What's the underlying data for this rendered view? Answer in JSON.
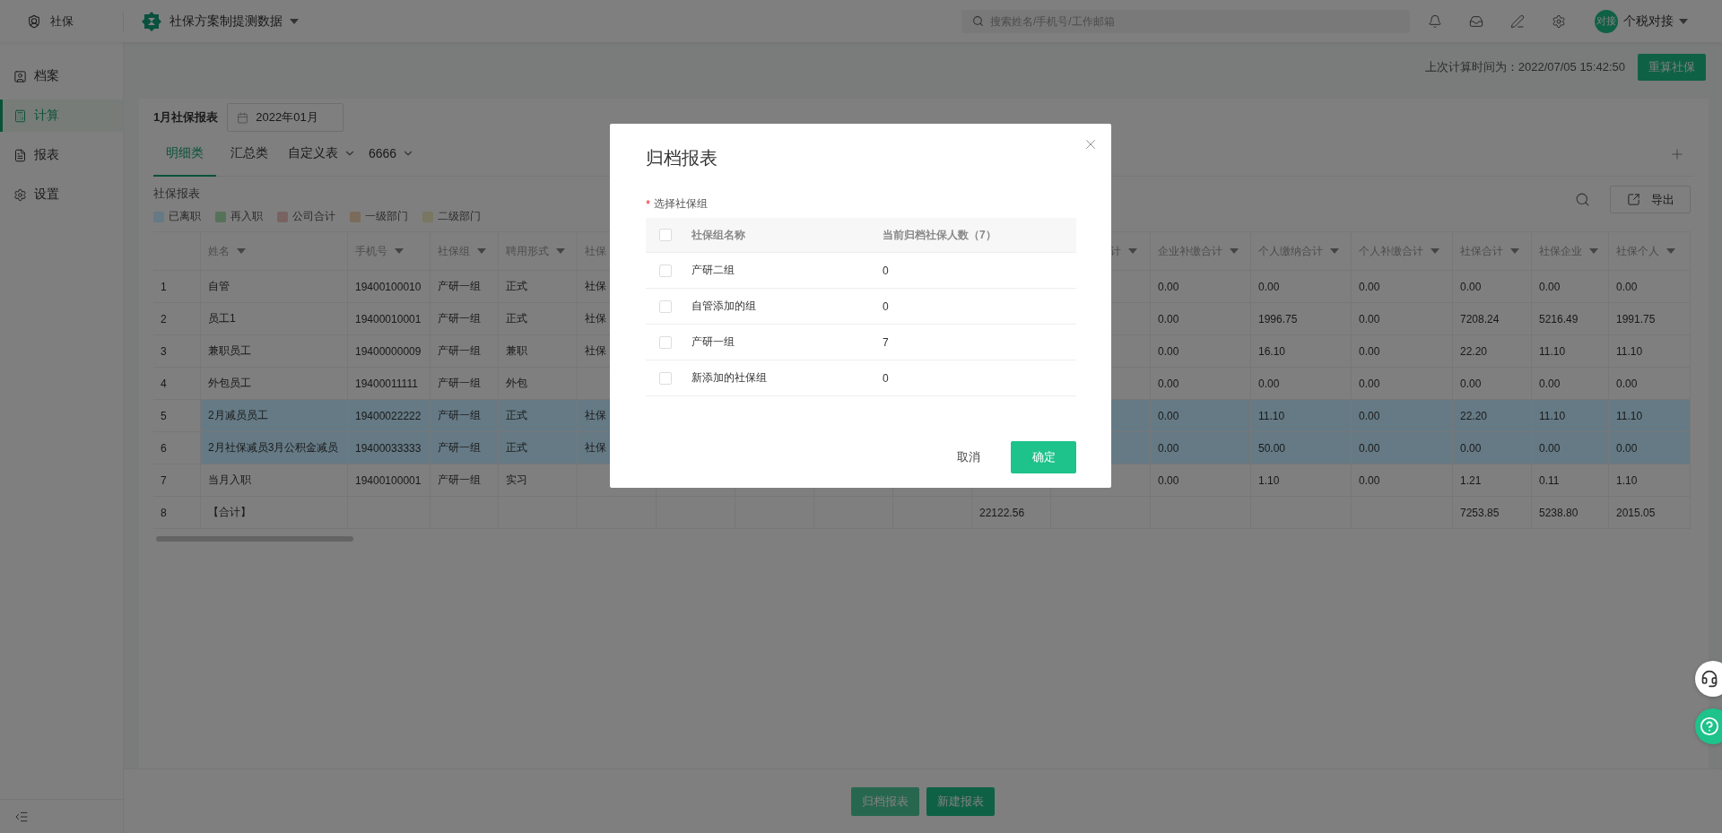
{
  "topbar": {
    "module": "社保",
    "scheme": "社保方案制提测数据",
    "search": {
      "placeholder": "搜索姓名/手机号/工作邮箱"
    },
    "user": {
      "avatar": "对接",
      "name": "个税对接"
    }
  },
  "sidebar": {
    "items": [
      {
        "label": "档案",
        "selected": false
      },
      {
        "label": "计算",
        "selected": true
      },
      {
        "label": "报表",
        "selected": false
      },
      {
        "label": "设置",
        "selected": false
      }
    ]
  },
  "info": {
    "last_calc": "上次计算时间为：2022/07/05 15:42:50",
    "recalc_button": "重算社保"
  },
  "report": {
    "title": "1月社保报表",
    "month": "2022年01月",
    "tabs": [
      {
        "label": "明细类",
        "selected": true,
        "dropdown": false
      },
      {
        "label": "汇总类",
        "selected": false,
        "dropdown": false
      },
      {
        "label": "自定义表",
        "selected": false,
        "dropdown": true
      },
      {
        "label": "6666",
        "selected": false,
        "dropdown": true
      }
    ],
    "table_title": "社保报表",
    "export_button": "导出",
    "legend": [
      {
        "label": "已离职",
        "color": "#657a85"
      },
      {
        "label": "再入职",
        "color": "#557259"
      },
      {
        "label": "公司合计",
        "color": "#796262"
      },
      {
        "label": "一级部门",
        "color": "#7a6b5a"
      },
      {
        "label": "二级部门",
        "color": "#797662"
      }
    ]
  },
  "table": {
    "columns": [
      {},
      {
        "header": "姓名",
        "sort": true
      },
      {
        "header": "手机号",
        "sort": true
      },
      {
        "header": "社保组",
        "sort": true
      },
      {
        "header": "聘用形式",
        "sort": true
      },
      {
        "header": "社保"
      },
      {},
      {},
      {},
      {},
      {},
      {
        "header": "计",
        "sort": true,
        "clipped": true
      },
      {
        "header": "企业补缴合计",
        "sort": true
      },
      {
        "header": "个人缴纳合计",
        "sort": true
      },
      {
        "header": "个人补缴合计",
        "sort": true
      },
      {
        "header": "社保合计",
        "sort": true
      },
      {
        "header": "社保企业",
        "sort": true
      },
      {
        "header": "社保个人",
        "sort": true
      }
    ],
    "rows": [
      {
        "cells": [
          "1",
          "自管",
          "19400100010",
          "产研一组",
          "正式",
          "社保",
          null,
          null,
          null,
          null,
          null,
          null,
          "0.00",
          "0.00",
          "0.00",
          "0.00",
          "0.00",
          "0.00"
        ]
      },
      {
        "cells": [
          "2",
          "员工1",
          "19400010001",
          "产研一组",
          "正式",
          "社保",
          null,
          null,
          null,
          null,
          null,
          null,
          "0.00",
          "1996.75",
          "0.00",
          "7208.24",
          "5216.49",
          "1991.75"
        ]
      },
      {
        "cells": [
          "3",
          "兼职员工",
          "19400000009",
          "产研一组",
          "兼职",
          "社保",
          null,
          null,
          null,
          null,
          null,
          null,
          "0.00",
          "16.10",
          "0.00",
          "22.20",
          "11.10",
          "11.10"
        ]
      },
      {
        "cells": [
          "4",
          "外包员工",
          "19400011111",
          "产研一组",
          "外包",
          null,
          null,
          null,
          null,
          null,
          null,
          null,
          "0.00",
          "0.00",
          "0.00",
          "0.00",
          "0.00",
          "0.00"
        ]
      },
      {
        "color": "#657a85",
        "cells": [
          "5",
          "2月减员员工",
          "19400022222",
          "产研一组",
          "正式",
          "社保",
          null,
          null,
          null,
          null,
          null,
          null,
          "0.00",
          "11.10",
          "0.00",
          "22.20",
          "11.10",
          "11.10"
        ]
      },
      {
        "color": "#657a85",
        "cells": [
          "6",
          "2月社保减员3月公积金减员",
          "19400033333",
          "产研一组",
          "正式",
          "社保",
          null,
          null,
          null,
          null,
          null,
          null,
          "0.00",
          "50.00",
          "0.00",
          "0.00",
          "0.00",
          "0.00"
        ]
      },
      {
        "cells": [
          "7",
          "当月入职",
          "19400100001",
          "产研一组",
          "实习",
          null,
          null,
          null,
          null,
          null,
          null,
          null,
          "0.00",
          "1.10",
          "0.00",
          "1.21",
          "0.11",
          "1.10"
        ]
      },
      {
        "cells": [
          "8",
          "【合计】",
          null,
          null,
          null,
          null,
          null,
          null,
          null,
          null,
          "22122.56",
          null,
          null,
          null,
          null,
          "7253.85",
          "5238.80",
          "2015.05"
        ]
      }
    ]
  },
  "footer": {
    "buttons": [
      {
        "label": "归档报表",
        "kind": "light"
      },
      {
        "label": "新建报表",
        "kind": "primary"
      }
    ]
  },
  "modal": {
    "title": "归档报表",
    "required_mark": "*",
    "field_label": "选择社保组",
    "header_checked": false,
    "columns": [
      "社保组名称",
      "当前归档社保人数（7）"
    ],
    "rows": [
      {
        "name": "产研二组",
        "count": "0",
        "checked": false
      },
      {
        "name": "自管添加的组",
        "count": "0",
        "checked": false
      },
      {
        "name": "产研一组",
        "count": "7",
        "checked": false
      },
      {
        "name": "新添加的社保组",
        "count": "0",
        "checked": false
      }
    ],
    "cancel": "取消",
    "confirm": "确定"
  }
}
